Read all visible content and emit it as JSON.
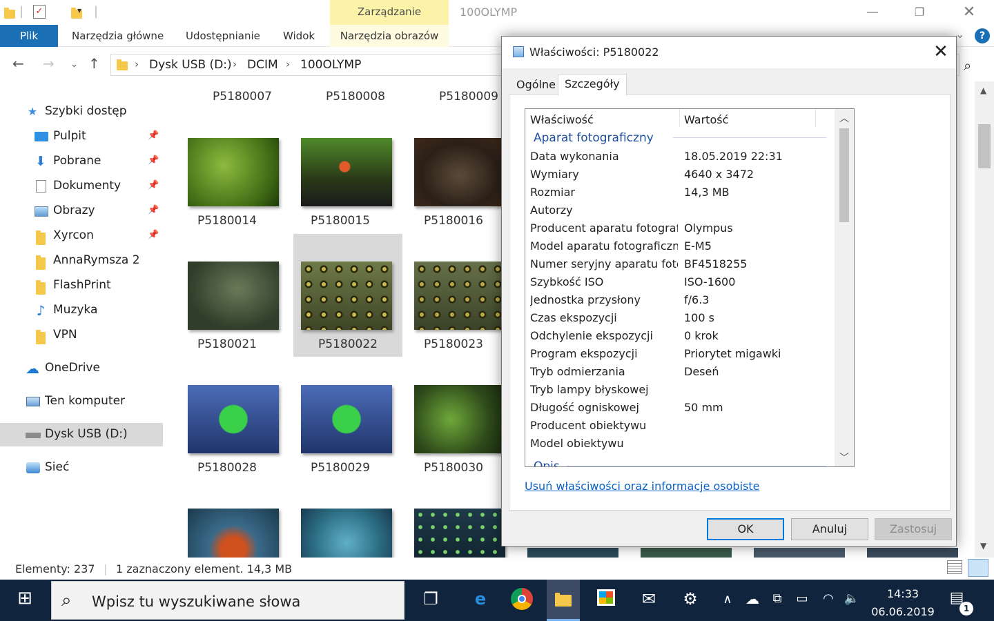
{
  "window": {
    "title": "100OLYMP",
    "context_tab": "Zarządzanie"
  },
  "ribbon": {
    "tabs": [
      "Plik",
      "Narzędzia główne",
      "Udostępnianie",
      "Widok",
      "Narzędzia obrazów"
    ]
  },
  "address": {
    "crumbs": [
      "Dysk USB (D:)",
      "DCIM",
      "100OLYMP"
    ]
  },
  "sidebar": {
    "items": [
      {
        "label": "Szybki dostęp",
        "icon": "star-icon"
      },
      {
        "label": "Pulpit",
        "icon": "desktop-icon",
        "pinned": true
      },
      {
        "label": "Pobrane",
        "icon": "download-icon",
        "pinned": true
      },
      {
        "label": "Dokumenty",
        "icon": "document-icon",
        "pinned": true
      },
      {
        "label": "Obrazy",
        "icon": "pictures-icon",
        "pinned": true
      },
      {
        "label": "Xyrcon",
        "icon": "folder-icon",
        "pinned": true
      },
      {
        "label": "AnnaRymsza 2",
        "icon": "folder-icon"
      },
      {
        "label": "FlashPrint",
        "icon": "folder-icon"
      },
      {
        "label": "Muzyka",
        "icon": "music-icon"
      },
      {
        "label": "VPN",
        "icon": "folder-icon"
      },
      {
        "label": "OneDrive",
        "icon": "cloud-icon"
      },
      {
        "label": "Ten komputer",
        "icon": "computer-icon"
      },
      {
        "label": "Dysk USB (D:)",
        "icon": "usb-drive-icon",
        "selected": true
      },
      {
        "label": "Sieć",
        "icon": "network-icon"
      }
    ]
  },
  "files": {
    "top_row": [
      "P5180007",
      "P5180008",
      "P5180009"
    ],
    "rows": [
      [
        "P5180014",
        "P5180015",
        "P5180016"
      ],
      [
        "P5180021",
        "P5180022",
        "P5180023"
      ],
      [
        "P5180028",
        "P5180029",
        "P5180030"
      ]
    ],
    "selected": "P5180022"
  },
  "status": {
    "count": "Elementy: 237",
    "selection": "1 zaznaczony element. 14,3 MB"
  },
  "taskbar": {
    "search_placeholder": "Wpisz tu wyszukiwane słowa",
    "time": "14:33",
    "date": "06.06.2019",
    "notifications": "1"
  },
  "dialog": {
    "title": "Właściwości: P5180022",
    "tabs": [
      "Ogólne",
      "Szczegóły"
    ],
    "active_tab": "Szczegóły",
    "columns": [
      "Właściwość",
      "Wartość"
    ],
    "group": "Aparat fotograficzny",
    "next_group": "Opis",
    "rows": [
      {
        "k": "Data wykonania",
        "v": "18.05.2019 22:31"
      },
      {
        "k": "Wymiary",
        "v": "4640 x 3472"
      },
      {
        "k": "Rozmiar",
        "v": "14,3 MB"
      },
      {
        "k": "Autorzy",
        "v": ""
      },
      {
        "k": "Producent aparatu fotografi...",
        "v": "Olympus"
      },
      {
        "k": "Model aparatu fotograficznego",
        "v": "E-M5"
      },
      {
        "k": "Numer seryjny aparatu foto...",
        "v": "BF4518255"
      },
      {
        "k": "Szybkość ISO",
        "v": "ISO-1600"
      },
      {
        "k": "Jednostka przysłony",
        "v": "f/6.3"
      },
      {
        "k": "Czas ekspozycji",
        "v": "100 s"
      },
      {
        "k": "Odchylenie ekspozycji",
        "v": "0 krok"
      },
      {
        "k": "Program ekspozycji",
        "v": "Priorytet migawki"
      },
      {
        "k": "Tryb odmierzania",
        "v": "Deseń"
      },
      {
        "k": "Tryb lampy błyskowej",
        "v": ""
      },
      {
        "k": "Długość ogniskowej",
        "v": "50 mm"
      },
      {
        "k": "Producent obiektywu",
        "v": ""
      },
      {
        "k": "Model obiektywu",
        "v": ""
      }
    ],
    "link": "Usuń właściwości oraz informacje osobiste",
    "buttons": {
      "ok": "OK",
      "cancel": "Anuluj",
      "apply": "Zastosuj"
    }
  }
}
